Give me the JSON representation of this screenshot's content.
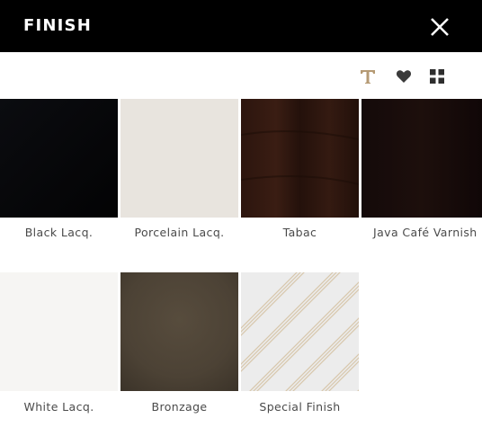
{
  "header": {
    "title": "FINISH"
  },
  "toolbar": {
    "text_icon": "text-t-icon",
    "fav_icon": "heart-icon",
    "grid_icon": "grid-icon",
    "accent": "#b59a74"
  },
  "swatches": [
    {
      "label": "Black Lacq.",
      "color": "#060709"
    },
    {
      "label": "Porcelain Lacq.",
      "color": "#e8e4de"
    },
    {
      "label": "Tabac",
      "color": "#2a140d"
    },
    {
      "label": "Java Café Varnish",
      "color": "#120909"
    },
    {
      "label": "White Lacq.",
      "color": "#f6f5f3"
    },
    {
      "label": "Bronzage",
      "color": "#4e4436"
    },
    {
      "label": "Special Finish",
      "color": "#ececec"
    }
  ]
}
